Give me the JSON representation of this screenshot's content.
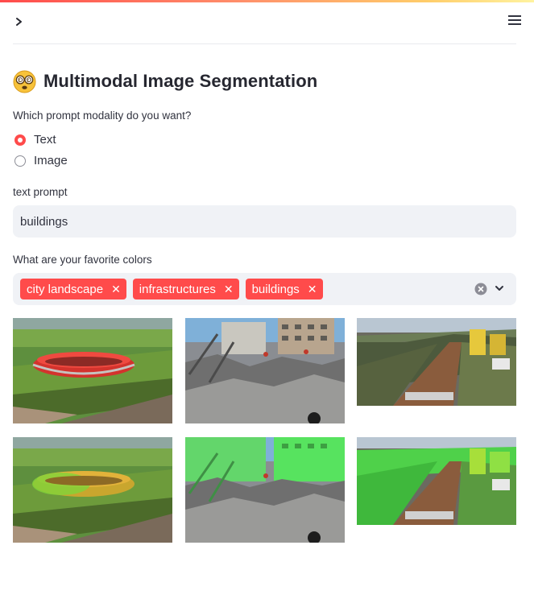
{
  "header": {
    "sidebar_toggle_icon": "chevron-right-icon",
    "menu_icon": "hamburger-menu-icon",
    "accent_colors": [
      "#ff4b4b",
      "#ffcd6a"
    ]
  },
  "main": {
    "title": "Multimodal Image Segmentation",
    "title_icon": "face-with-spiral-eyes-emoji",
    "modality": {
      "label": "Which prompt modality do you want?",
      "options": [
        "Text",
        "Image"
      ],
      "selected": "Text"
    },
    "text_prompt": {
      "label": "text prompt",
      "value": "buildings"
    },
    "colors": {
      "label": "What are your favorite colors",
      "selected_tags": [
        "city landscape",
        "infrastructures",
        "buildings"
      ],
      "clear_icon": "clear-all-icon",
      "dropdown_icon": "chevron-down-icon"
    },
    "gallery": {
      "original_images": [
        "stadium aerial view",
        "collapsed building rubble",
        "flooded city street"
      ],
      "segmented_images": [
        "stadium with mask overlay",
        "rubble with building mask",
        "street with building mask"
      ]
    }
  },
  "theme": {
    "primary": "#ff4b4b",
    "input_bg": "#f0f2f6",
    "mask_color": "#39d353"
  }
}
